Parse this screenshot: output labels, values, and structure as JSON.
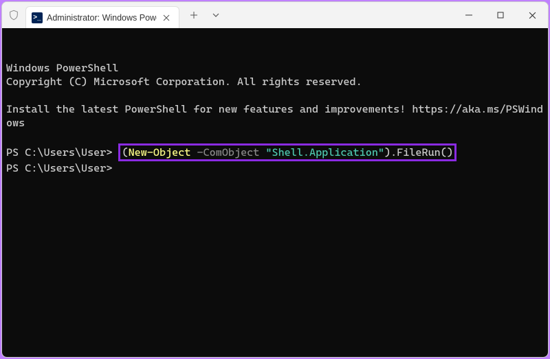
{
  "window": {
    "tab_title": "Administrator: Windows Powe",
    "icon_label": ">_"
  },
  "terminal": {
    "line1": "Windows PowerShell",
    "line2": "Copyright (C) Microsoft Corporation. All rights reserved.",
    "line3": "Install the latest PowerShell for new features and improvements! https://aka.ms/PSWindows",
    "prompt1": "PS C:\\Users\\User> ",
    "prompt2": "PS C:\\Users\\User> ",
    "command": {
      "open_paren": "(",
      "cmdlet": "New-Object",
      "space1": " ",
      "param": "-ComObject",
      "space2": " ",
      "string": "\"Shell.Application\"",
      "close_paren": ")",
      "method": ".FileRun()"
    }
  }
}
